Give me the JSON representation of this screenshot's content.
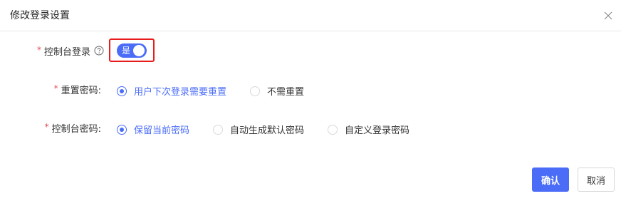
{
  "dialog": {
    "title": "修改登录设置",
    "close_icon": "close-icon"
  },
  "form": {
    "console_login": {
      "label": "控制台登录",
      "required_mark": "*",
      "help_icon": "question-circle-icon",
      "switch_text": "是",
      "enabled": true
    },
    "reset_password": {
      "label": "重置密码:",
      "required_mark": "*",
      "options": [
        "用户下次登录需要重置",
        "不需重置"
      ],
      "selected_index": 0
    },
    "console_password": {
      "label": "控制台密码:",
      "required_mark": "*",
      "options": [
        "保留当前密码",
        "自动生成默认密码",
        "自定义登录密码"
      ],
      "selected_index": 0
    }
  },
  "footer": {
    "confirm_label": "确认",
    "cancel_label": "取消"
  },
  "colors": {
    "accent": "#4a6cf7",
    "highlight_border": "#e81c1c",
    "required": "#e34d59"
  }
}
